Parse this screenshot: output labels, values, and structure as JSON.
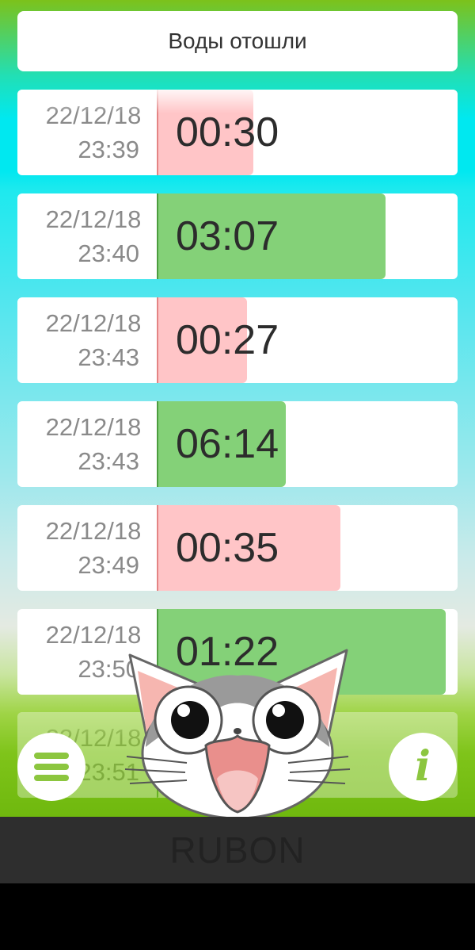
{
  "top_button": {
    "label": "Воды отошли"
  },
  "entries": [
    {
      "date": "22/12/18",
      "time": "23:39",
      "duration": "00:30",
      "status": "red",
      "fill": 0.32
    },
    {
      "date": "22/12/18",
      "time": "23:40",
      "duration": "03:07",
      "status": "green",
      "fill": 0.76
    },
    {
      "date": "22/12/18",
      "time": "23:43",
      "duration": "00:27",
      "status": "red",
      "fill": 0.3
    },
    {
      "date": "22/12/18",
      "time": "23:43",
      "duration": "06:14",
      "status": "green",
      "fill": 0.43
    },
    {
      "date": "22/12/18",
      "time": "23:49",
      "duration": "00:35",
      "status": "red",
      "fill": 0.61
    },
    {
      "date": "22/12/18",
      "time": "23:50",
      "duration": "01:22",
      "status": "green",
      "fill": 0.96
    },
    {
      "date": "22/12/18",
      "time": "23:51",
      "duration": "",
      "status": "green",
      "fill": 0.0
    }
  ],
  "colors": {
    "green_bar": "#84d178",
    "red_bar": "#ffc5c7",
    "accent": "#8cc63f"
  },
  "icons": {
    "menu": "hamburger-icon",
    "info": "info-icon",
    "mascot": "cat-mascot"
  },
  "info_button": {
    "glyph": "i"
  },
  "banner": {
    "text": "RUBON"
  }
}
